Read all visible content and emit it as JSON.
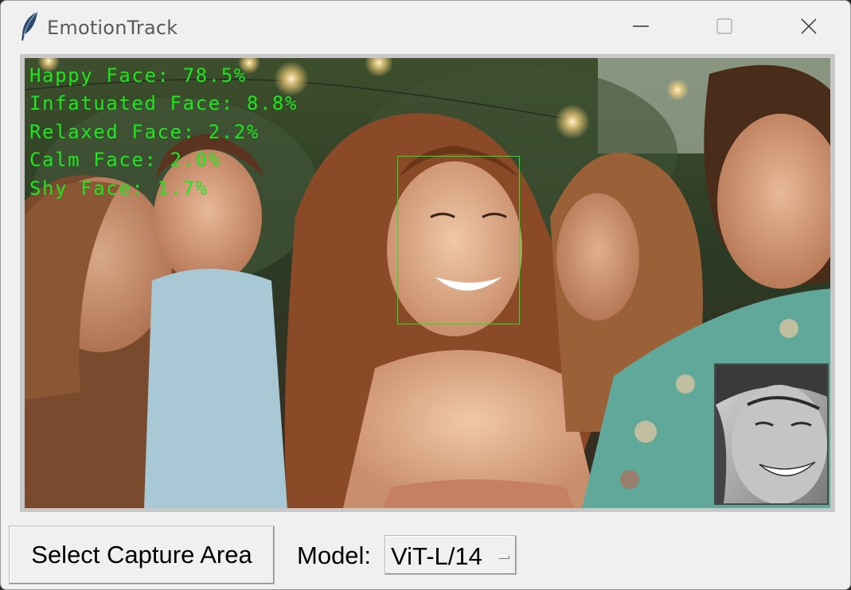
{
  "window": {
    "title": "EmotionTrack"
  },
  "titlebar": {
    "app_icon": "feather-icon",
    "minimize_icon": "minimize-icon",
    "maximize_icon": "maximize-icon",
    "close_icon": "close-icon"
  },
  "preview": {
    "emotions": [
      {
        "label": "Happy Face: 78.5%"
      },
      {
        "label": "Infatuated Face: 8.8%"
      },
      {
        "label": "Relaxed Face: 2.2%"
      },
      {
        "label": "Calm Face: 2.0%"
      },
      {
        "label": "Shy Face: 1.7%"
      }
    ],
    "overlay_color": "#1ee61e"
  },
  "controls": {
    "capture_button_label": "Select Capture Area",
    "model_label": "Model:",
    "model_value": "ViT-L/14"
  }
}
